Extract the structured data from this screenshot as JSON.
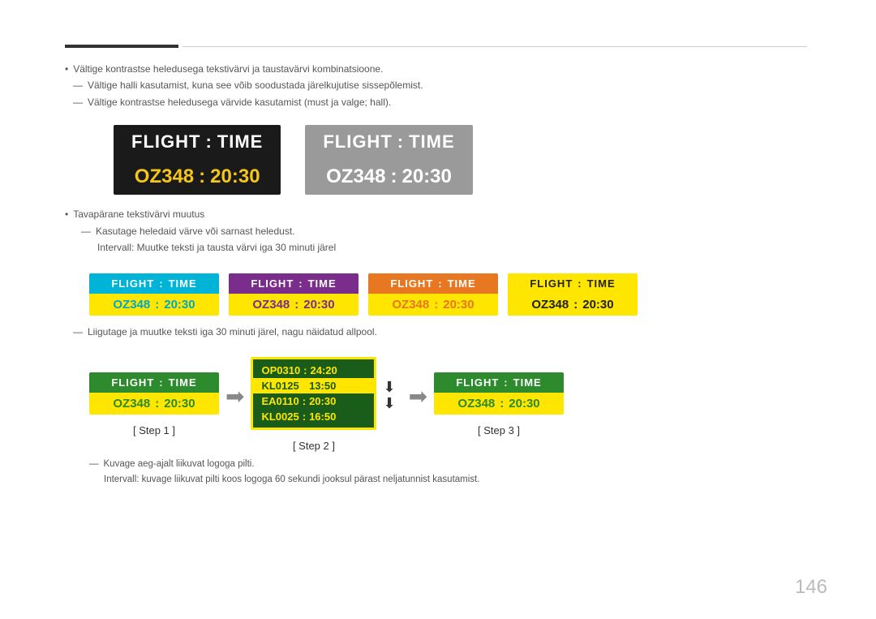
{
  "page": {
    "number": "146"
  },
  "topText": {
    "bullet1": "Vältige kontrastse heledusega tekstivärvi ja taustavärvi kombinatsioone.",
    "dash1": "Vältige halli kasutamist, kuna see võib soodustada järelkujutise sissepõlemist.",
    "dash2": "Vältige kontrastse heledusega värvide kasutamist (must ja valge; hall)."
  },
  "flightCards": {
    "label1": "FLIGHT",
    "label2": "TIME",
    "colon": ":",
    "code": "OZ348",
    "time": "20:30"
  },
  "middleText": {
    "bullet1": "Tavapärane tekstivärvi muutus",
    "dash1": "Kasutage heledaid värve või sarnast heledust.",
    "dash2": "Intervall: Muutke teksti ja tausta värvi iga 30 minuti järel"
  },
  "stepsText": {
    "dash1": "Liigutage ja muutke teksti iga 30 minuti järel, nagu näidatud allpool."
  },
  "steps": {
    "step1": "[ Step 1 ]",
    "step2": "[ Step 2 ]",
    "step3": "[ Step 3 ]"
  },
  "scrollFlights": [
    {
      "code": "OP0310",
      "time": "24:20",
      "highlighted": false
    },
    {
      "code": "KL0125",
      "time": "13:50",
      "highlighted": true
    },
    {
      "code": "EA0110",
      "time": "20:30",
      "highlighted": false
    },
    {
      "code": "KL0025",
      "time": "16:50",
      "highlighted": false
    }
  ],
  "bottomText": {
    "dash1": "Kuvage aeg-ajalt liikuvat logoga pilti.",
    "dash2": "Intervall: kuvage liikuvat pilti koos logoga 60 sekundi jooksul pärast neljatunnist kasutamist."
  }
}
